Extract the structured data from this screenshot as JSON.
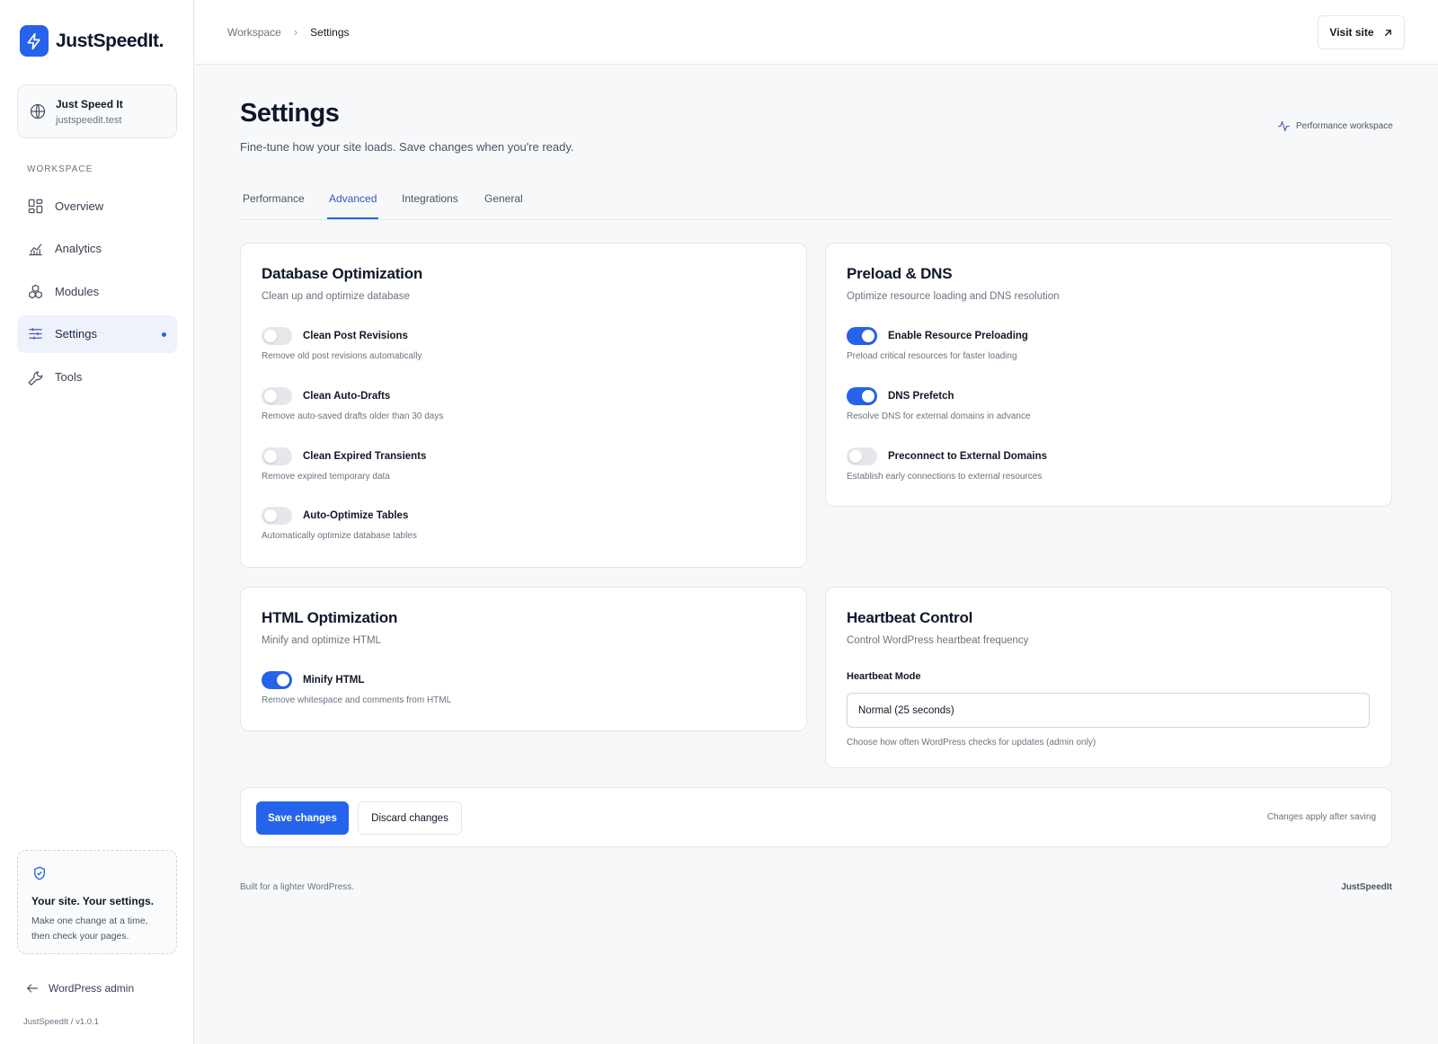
{
  "brand": {
    "name": "JustSpeedIt.",
    "accent": "#2563eb"
  },
  "site": {
    "name": "Just Speed It",
    "url": "justspeedit.test",
    "icon": "globe-icon"
  },
  "sidebar": {
    "section_label": "WORKSPACE",
    "items": [
      {
        "label": "Overview",
        "icon": "grid-icon"
      },
      {
        "label": "Analytics",
        "icon": "chart-icon"
      },
      {
        "label": "Modules",
        "icon": "modules-icon"
      },
      {
        "label": "Settings",
        "icon": "sliders-icon",
        "active": true
      },
      {
        "label": "Tools",
        "icon": "wrench-icon"
      }
    ],
    "tip": {
      "title": "Your site. Your settings.",
      "body": "Make one change at a time, then check your pages.",
      "icon": "shield-check-icon"
    },
    "wp_admin": "WordPress admin",
    "version": "JustSpeedIt / v1.0.1"
  },
  "breadcrumb": {
    "parent": "Workspace",
    "separator": "›",
    "current": "Settings"
  },
  "topbar": {
    "visit_label": "Visit site"
  },
  "header": {
    "title": "Settings",
    "subtitle": "Fine-tune how your site loads. Save changes when you're ready.",
    "badge": "Performance workspace"
  },
  "tabs": [
    "Performance",
    "Advanced",
    "Integrations",
    "General"
  ],
  "active_tab": "Advanced",
  "cards": {
    "database": {
      "title": "Database Optimization",
      "subtitle": "Clean up and optimize database",
      "options": [
        {
          "label": "Clean Post Revisions",
          "desc": "Remove old post revisions automatically",
          "enabled": false
        },
        {
          "label": "Clean Auto-Drafts",
          "desc": "Remove auto-saved drafts older than 30 days",
          "enabled": false
        },
        {
          "label": "Clean Expired Transients",
          "desc": "Remove expired temporary data",
          "enabled": false
        },
        {
          "label": "Auto-Optimize Tables",
          "desc": "Automatically optimize database tables",
          "enabled": false
        }
      ]
    },
    "preload": {
      "title": "Preload & DNS",
      "subtitle": "Optimize resource loading and DNS resolution",
      "options": [
        {
          "label": "Enable Resource Preloading",
          "desc": "Preload critical resources for faster loading",
          "enabled": true
        },
        {
          "label": "DNS Prefetch",
          "desc": "Resolve DNS for external domains in advance",
          "enabled": true
        },
        {
          "label": "Preconnect to External Domains",
          "desc": "Establish early connections to external resources",
          "enabled": false
        }
      ]
    },
    "html": {
      "title": "HTML Optimization",
      "subtitle": "Minify and optimize HTML",
      "options": [
        {
          "label": "Minify HTML",
          "desc": "Remove whitespace and comments from HTML",
          "enabled": true
        }
      ]
    },
    "heartbeat": {
      "title": "Heartbeat Control",
      "subtitle": "Control WordPress heartbeat frequency",
      "field_label": "Heartbeat Mode",
      "selected": "Normal (25 seconds)",
      "help": "Choose how often WordPress checks for updates (admin only)"
    }
  },
  "actions": {
    "save": "Save changes",
    "discard": "Discard changes",
    "note": "Changes apply after saving"
  },
  "footer": {
    "left": "Built for a lighter WordPress.",
    "right": "JustSpeedIt"
  }
}
